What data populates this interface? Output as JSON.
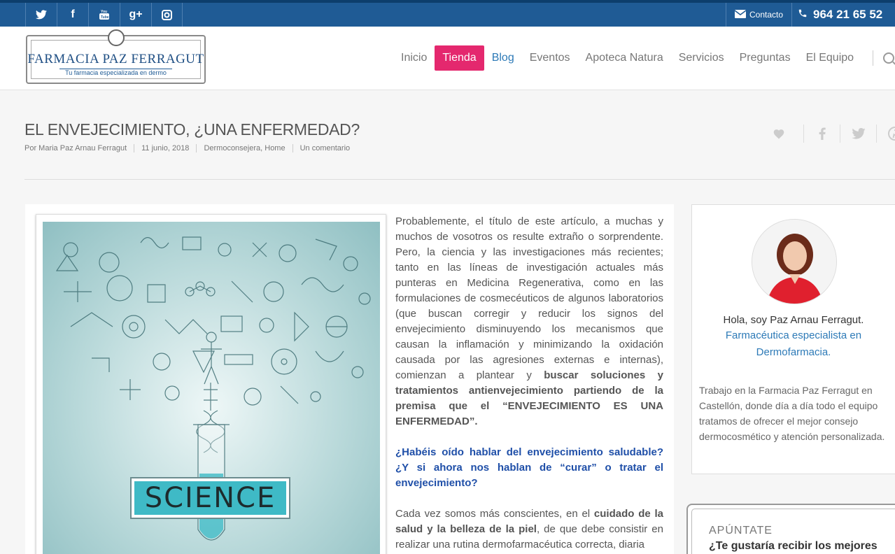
{
  "topbar": {
    "social": [
      {
        "icon": "twitter-icon",
        "glyph": "🐦"
      },
      {
        "icon": "facebook-icon",
        "glyph": "f"
      },
      {
        "icon": "youtube-icon",
        "glyph": "▶"
      },
      {
        "icon": "google-plus-icon",
        "glyph": "g+"
      },
      {
        "icon": "instagram-icon",
        "glyph": "◎"
      }
    ],
    "contact_label": "Contacto",
    "phone": "964 21 65 52"
  },
  "logo": {
    "title": "FARMACIA PAZ FERRAGUT",
    "tagline": "Tu farmacia especializada en dermo"
  },
  "nav": {
    "items": [
      "Inicio",
      "Tienda",
      "Blog",
      "Eventos",
      "Apoteca Natura",
      "Servicios",
      "Preguntas",
      "El Equipo"
    ],
    "active": "Tienda"
  },
  "post": {
    "title": "EL ENVEJECIMIENTO, ¿UNA ENFERMEDAD?",
    "author": "Por Maria Paz Arnau Ferragut",
    "date": "11 junio, 2018",
    "categories": "Dermoconsejera, Home",
    "comments": "Un comentario"
  },
  "figure": {
    "label": "SCIENCE"
  },
  "article": {
    "p1_a": "Probablemente, el título de este artículo, a muchas y muchos de vosotros os resulte extraño o sorprendente. Pero, la ciencia y las investigaciones más recientes; tanto en las líneas de investigación actuales más punteras en Medicina Regenerativa, como en las formulaciones de cosmecéuticos de algunos laboratorios (que buscan corregir y reducir los signos del envejecimiento disminuyendo los mecanismos que causan la inflamación y minimizando la oxidación causada por las agresiones externas e internas), comienzan a plantear y ",
    "p1_b": "buscar soluciones y tratamientos antienvejecimiento partiendo de la premisa que el “ENVEJECIMIENTO ES UNA ENFERMEDAD”.",
    "p2": "¿Habéis oído hablar del envejecimiento saludable? ¿Y si ahora nos hablan de “curar” o tratar el envejecimiento?",
    "p3_a": "Cada vez somos más conscientes, en el ",
    "p3_b": "cuidado de la salud y la belleza de la piel",
    "p3_c": ", de que debe consistir en realizar una rutina dermofarmacéutica correcta, diaria"
  },
  "sidebar": {
    "greeting": "Hola, soy Paz Arnau Ferragut.",
    "role": "Farmacéutica especialista en Dermofarmacia.",
    "bio": "Trabajo en la Farmacia Paz Ferragut en Castellón, donde día a día todo el equipo tratamos de ofrecer el mejor consejo dermocosmético y atención personalizada.",
    "news_kicker": "APÚNTATE",
    "news_title": "¿Te gustaría recibir los mejores"
  }
}
